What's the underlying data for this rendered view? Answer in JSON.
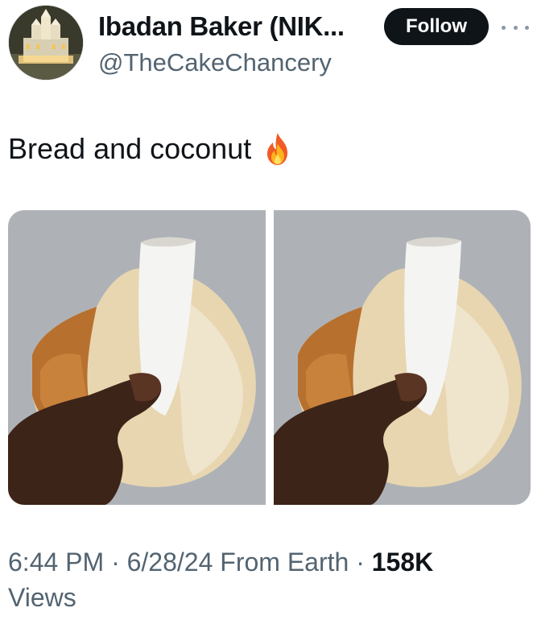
{
  "author": {
    "display_name": "Ibadan Baker (NIK...",
    "handle": "@TheCakeChancery",
    "avatar_icon": "castle-cake-avatar"
  },
  "actions": {
    "follow_label": "Follow",
    "more_icon": "more-options-icon"
  },
  "tweet": {
    "text": "Bread and coconut",
    "emoji_icon": "fire-icon"
  },
  "media": {
    "photos": [
      {
        "subject": "hand-holding-bread-with-coconut"
      },
      {
        "subject": "hand-holding-bread-with-coconut"
      }
    ]
  },
  "meta": {
    "time": "6:44 PM",
    "separator": "·",
    "date": "6/28/24",
    "source": "From Earth",
    "views_count": "158K",
    "views_label": "Views"
  },
  "colors": {
    "text": "#0f1419",
    "secondary_text": "#536471",
    "follow_bg": "#0f1419",
    "follow_text": "#ffffff",
    "photo_bg": "#aeb2b7"
  }
}
